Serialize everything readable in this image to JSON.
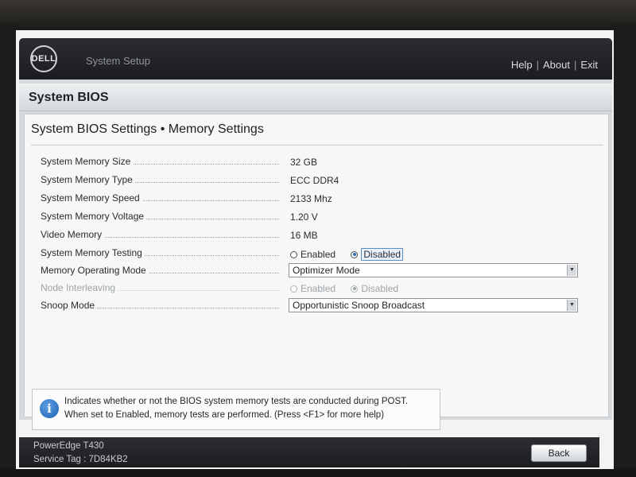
{
  "header": {
    "logo_text": "DELL",
    "title": "System Setup",
    "links": {
      "help": "Help",
      "about": "About",
      "exit": "Exit"
    },
    "separator": "|"
  },
  "panel": {
    "title": "System BIOS",
    "breadcrumb": "System BIOS Settings • Memory Settings"
  },
  "settings": {
    "memory_size": {
      "label": "System Memory Size",
      "value": "32 GB"
    },
    "memory_type": {
      "label": "System Memory Type",
      "value": "ECC DDR4"
    },
    "memory_speed": {
      "label": "System Memory Speed",
      "value": "2133 Mhz"
    },
    "memory_voltage": {
      "label": "System Memory Voltage",
      "value": "1.20 V"
    },
    "video_memory": {
      "label": "Video Memory",
      "value": "16 MB"
    },
    "memory_testing": {
      "label": "System Memory Testing",
      "option1": "Enabled",
      "option2": "Disabled",
      "selected": "Disabled"
    },
    "operating_mode": {
      "label": "Memory Operating Mode",
      "value": "Optimizer Mode"
    },
    "node_interleaving": {
      "label": "Node Interleaving",
      "option1": "Enabled",
      "option2": "Disabled",
      "selected": "Disabled",
      "disabled": true
    },
    "snoop_mode": {
      "label": "Snoop Mode",
      "value": "Opportunistic Snoop Broadcast"
    }
  },
  "info": {
    "icon": "info-icon",
    "line1": "Indicates whether or not the BIOS system memory tests are conducted during POST.",
    "line2": "When set to Enabled, memory tests are performed. (Press <F1> for more help)"
  },
  "footer": {
    "model": "PowerEdge T430",
    "service_tag": "Service Tag : 7D84KB2",
    "back_label": "Back"
  },
  "colors": {
    "header_bg": "#1f2023",
    "panel_bg": "#d7dadd",
    "content_bg": "#f6f7f6",
    "accent": "#2e6fb4"
  }
}
